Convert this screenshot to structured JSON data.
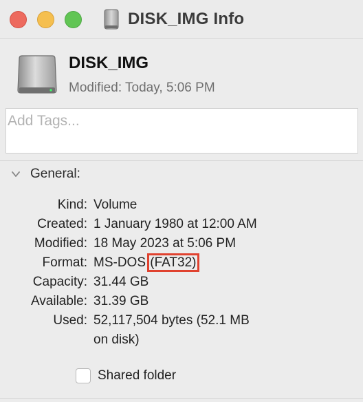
{
  "window": {
    "title": "DISK_IMG Info"
  },
  "file": {
    "name": "DISK_IMG",
    "modified_label": "Modified:",
    "modified_value": "Today, 5:06 PM",
    "icon": "drive-icon"
  },
  "tags": {
    "placeholder": "Add Tags..."
  },
  "general": {
    "label": "General:",
    "rows": [
      {
        "key": "Kind:",
        "value": "Volume"
      },
      {
        "key": "Created:",
        "value": "1 January 1980 at 12:00 AM"
      },
      {
        "key": "Modified:",
        "value": "18 May 2023 at 5:06 PM"
      },
      {
        "key": "Format:",
        "value": "MS-DOS",
        "value_highlight": "(FAT32)"
      },
      {
        "key": "Capacity:",
        "value": "31.44 GB"
      },
      {
        "key": "Available:",
        "value": "31.39 GB"
      },
      {
        "key": "Used:",
        "value": "52,117,504 bytes (52.1 MB",
        "value_cont": "on disk)"
      }
    ],
    "shared_folder_label": "Shared folder",
    "shared_folder_checked": false
  },
  "colors": {
    "highlight": "#e0422f",
    "close": "#ed6a5e",
    "minimize": "#f5bf4f",
    "maximize": "#61c554"
  }
}
